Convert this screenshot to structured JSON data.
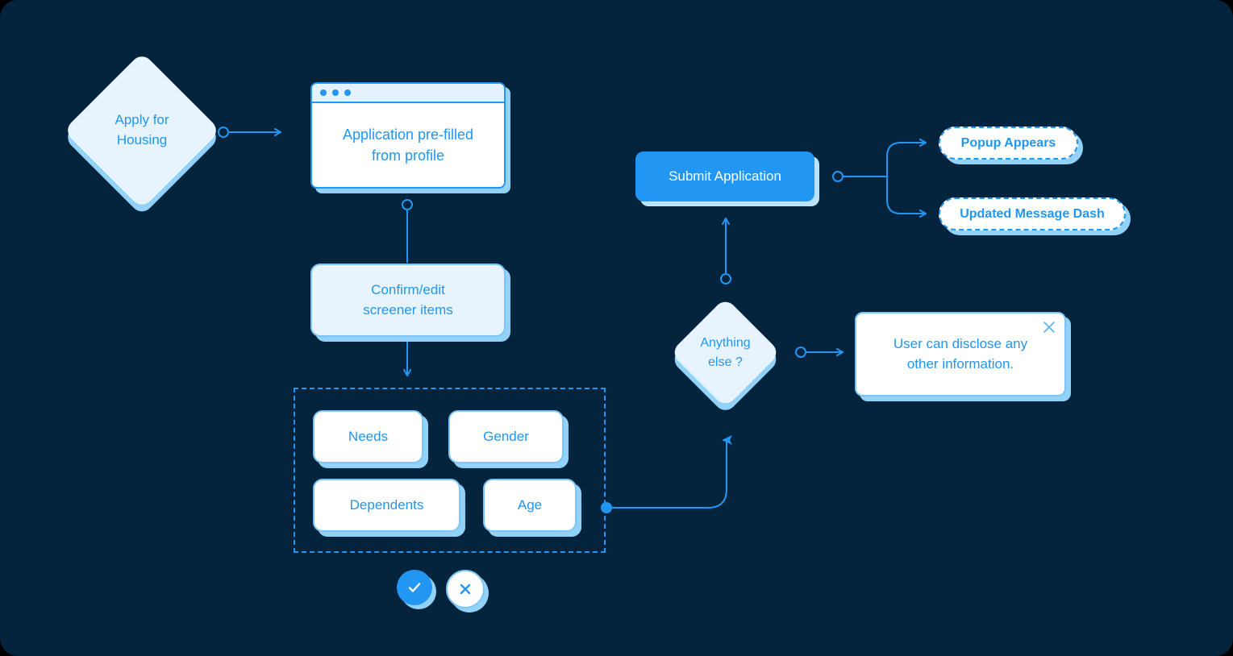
{
  "theme": {
    "background": "#04243d",
    "accent": "#2196f3",
    "soft_fill": "#e8f4fd",
    "shadow": "#93d2f8",
    "card_fill": "#ffffff"
  },
  "diagram": {
    "type": "flowchart",
    "nodes": [
      {
        "id": "apply",
        "shape": "diamond",
        "line1": "Apply for",
        "line2": "Housing"
      },
      {
        "id": "prefilled",
        "shape": "browser-window",
        "line1": "Application pre-filled",
        "line2": "from profile"
      },
      {
        "id": "confirm",
        "shape": "rounded-box",
        "line1": "Confirm/edit",
        "line2": "screener items"
      },
      {
        "id": "submit",
        "shape": "button",
        "label": "Submit Application"
      },
      {
        "id": "anything",
        "shape": "diamond",
        "line1": "Anything",
        "line2": "else ?"
      },
      {
        "id": "popup",
        "shape": "dashed-pill",
        "label": "Popup Appears"
      },
      {
        "id": "message_dash",
        "shape": "dashed-pill",
        "label": "Updated Message Dash"
      },
      {
        "id": "disclose",
        "shape": "tooltip-card",
        "line1": "User can disclose any",
        "line2": "other information."
      }
    ],
    "screener_group": {
      "shape": "dashed-container",
      "cards": [
        {
          "label": "Needs"
        },
        {
          "label": "Gender"
        },
        {
          "label": "Dependents"
        },
        {
          "label": "Age"
        }
      ]
    },
    "actions": [
      {
        "id": "accept",
        "icon": "check-icon"
      },
      {
        "id": "reject",
        "icon": "close-icon"
      }
    ],
    "edges": [
      {
        "from": "apply",
        "to": "prefilled"
      },
      {
        "from": "prefilled",
        "to": "confirm"
      },
      {
        "from": "confirm",
        "to": "screener_group"
      },
      {
        "from": "screener_group",
        "to": "anything"
      },
      {
        "from": "anything",
        "to": "submit"
      },
      {
        "from": "anything",
        "to": "disclose"
      },
      {
        "from": "submit",
        "to": "popup"
      },
      {
        "from": "submit",
        "to": "message_dash"
      }
    ]
  }
}
